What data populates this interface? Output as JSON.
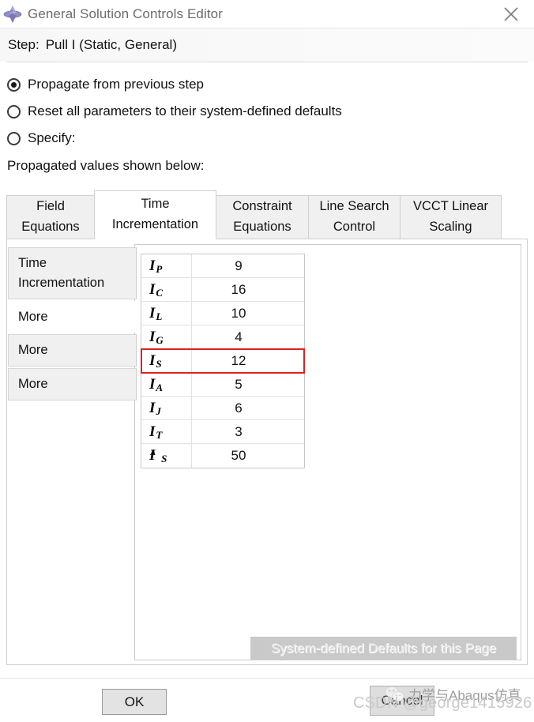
{
  "window": {
    "title": "General Solution Controls Editor",
    "icon": "abaqus-diamond-icon",
    "close_label": "✕"
  },
  "step": {
    "label": "Step:",
    "value": "Pull I (Static, General)"
  },
  "options": {
    "items": [
      {
        "label": "Propagate from previous step",
        "selected": true
      },
      {
        "label": "Reset all parameters to their system-defined defaults",
        "selected": false
      },
      {
        "label": "Specify:",
        "selected": false
      }
    ],
    "note": "Propagated values shown below:"
  },
  "tabs": [
    {
      "line1": "Field",
      "line2": "Equations",
      "active": false
    },
    {
      "line1": "Time",
      "line2": "Incrementation",
      "active": true
    },
    {
      "line1": "Constraint",
      "line2": "Equations",
      "active": false
    },
    {
      "line1": "Line Search",
      "line2": "Control",
      "active": false
    },
    {
      "line1": "VCCT Linear",
      "line2": "Scaling",
      "active": false
    }
  ],
  "subtabs": [
    {
      "line1": "Time",
      "line2": "Incrementation",
      "active": false
    },
    {
      "line1": "More",
      "line2": "",
      "active": true
    },
    {
      "line1": "More",
      "line2": "",
      "active": false
    },
    {
      "line1": "More",
      "line2": "",
      "active": false
    }
  ],
  "table": {
    "rows": [
      {
        "base": "I",
        "sub": "P",
        "sup": "",
        "value": "9",
        "highlight": false
      },
      {
        "base": "I",
        "sub": "C",
        "sup": "",
        "value": "16",
        "highlight": false
      },
      {
        "base": "I",
        "sub": "L",
        "sup": "",
        "value": "10",
        "highlight": false
      },
      {
        "base": "I",
        "sub": "G",
        "sup": "",
        "value": "4",
        "highlight": false
      },
      {
        "base": "I",
        "sub": "S",
        "sup": "",
        "value": "12",
        "highlight": true
      },
      {
        "base": "I",
        "sub": "A",
        "sup": "",
        "value": "5",
        "highlight": false
      },
      {
        "base": "I",
        "sub": "J",
        "sup": "",
        "value": "6",
        "highlight": false
      },
      {
        "base": "I",
        "sub": "T",
        "sup": "",
        "value": "3",
        "highlight": false
      },
      {
        "base": "I",
        "sub": "S",
        "sup": "A",
        "value": "50",
        "highlight": false
      }
    ],
    "highlight_color": "#e02020"
  },
  "defaults_button": {
    "label": "System-defined Defaults for this Page",
    "enabled": false
  },
  "footer": {
    "ok_label": "OK",
    "cancel_label": "Cancel"
  },
  "watermarks": {
    "csdn": "CSDN @george1415926",
    "wechat": "力学与Abaqus仿真"
  }
}
